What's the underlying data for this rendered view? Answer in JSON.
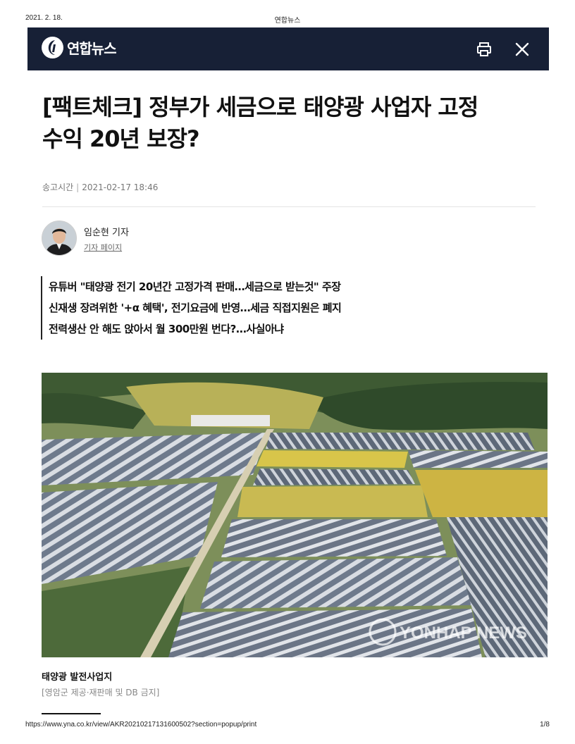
{
  "print_header": {
    "date": "2021. 2. 18.",
    "site_title": "연합뉴스"
  },
  "topbar": {
    "brand": "연합뉴스",
    "print_icon": "printer-icon",
    "close_icon": "close-icon",
    "background": "#172036"
  },
  "article": {
    "headline_line1": "[팩트체크] 정부가 세금으로 태양광 사업자 고정",
    "headline_line2": "수익 20년 보장?",
    "meta_label": "송고시간",
    "meta_time": "2021-02-17 18:46",
    "reporter": {
      "name": "임순현 기자",
      "page_link": "기자 페이지"
    },
    "summary": [
      "유튜버 \"태양광 전기 20년간 고정가격 판매…세금으로 받는것\" 주장",
      "신재생 장려위한 '+α 혜택', 전기요금에 반영…세금 직접지원은 폐지",
      "전력생산 안 해도 앉아서 월 300만원 번다?…사실아냐"
    ],
    "photo": {
      "watermark": "YONHAP NEWS",
      "caption_title": "태양광 발전사업지",
      "caption_credit": "[영암군 제공·재판매 및 DB 금지]"
    }
  },
  "print_footer": {
    "url": "https://www.yna.co.kr/view/AKR20210217131600502?section=popup/print",
    "page": "1/8"
  }
}
